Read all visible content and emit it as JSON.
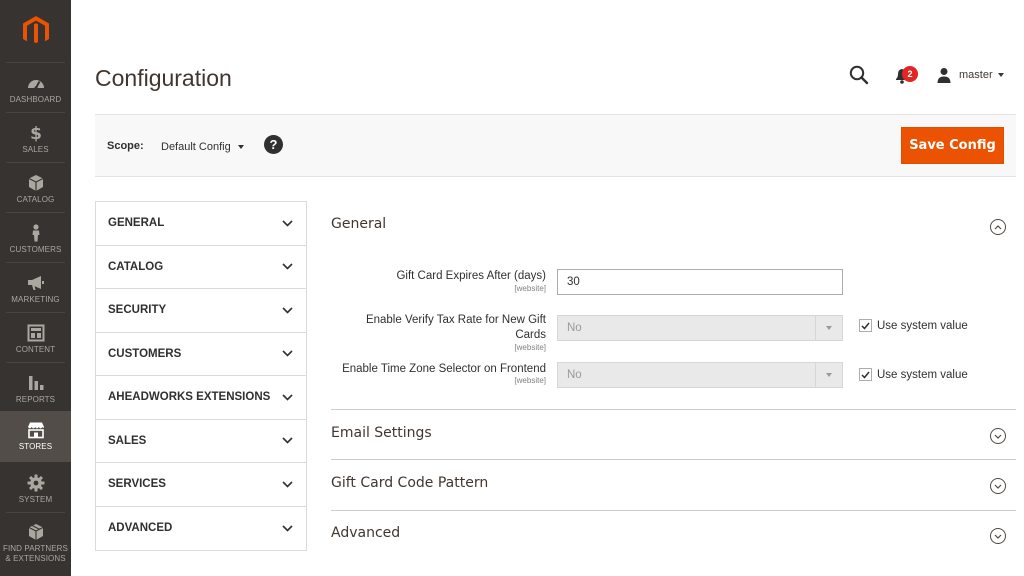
{
  "nav": {
    "items": [
      {
        "key": "dashboard",
        "label": "DASHBOARD"
      },
      {
        "key": "sales",
        "label": "SALES"
      },
      {
        "key": "catalog",
        "label": "CATALOG"
      },
      {
        "key": "customers",
        "label": "CUSTOMERS"
      },
      {
        "key": "marketing",
        "label": "MARKETING"
      },
      {
        "key": "content",
        "label": "CONTENT"
      },
      {
        "key": "reports",
        "label": "REPORTS"
      },
      {
        "key": "stores",
        "label": "STORES",
        "active": true
      },
      {
        "key": "system",
        "label": "SYSTEM"
      },
      {
        "key": "partners",
        "label": "FIND PARTNERS & EXTENSIONS"
      }
    ],
    "logo_icon": "magento-logo",
    "logo_color": "#eb5202"
  },
  "header": {
    "title": "Configuration",
    "notification_count": "2",
    "username": "master"
  },
  "scope": {
    "label": "Scope:",
    "value": "Default Config",
    "help": "?",
    "save_label": "Save Config"
  },
  "sections": [
    {
      "label": "GENERAL"
    },
    {
      "label": "CATALOG"
    },
    {
      "label": "SECURITY"
    },
    {
      "label": "CUSTOMERS"
    },
    {
      "label": "AHEADWORKS EXTENSIONS"
    },
    {
      "label": "SALES"
    },
    {
      "label": "SERVICES"
    },
    {
      "label": "ADVANCED"
    }
  ],
  "groups": {
    "general": {
      "title": "General",
      "expanded": true,
      "fields": {
        "expires": {
          "label": "Gift Card Expires After (days)",
          "scope": "[website]",
          "value": "30"
        },
        "verify_tax": {
          "label": "Enable Verify Tax Rate for New Gift Cards",
          "scope": "[website]",
          "value": "No",
          "use_system": "Use system value",
          "checked": true
        },
        "timezone": {
          "label": "Enable Time Zone Selector on Frontend",
          "scope": "[website]",
          "value": "No",
          "use_system": "Use system value",
          "checked": true
        }
      }
    },
    "email": {
      "title": "Email Settings",
      "expanded": false
    },
    "code_pattern": {
      "title": "Gift Card Code Pattern",
      "expanded": false
    },
    "advanced": {
      "title": "Advanced",
      "expanded": false
    }
  },
  "colors": {
    "accent": "#eb5202",
    "sidebar": "#373330",
    "badge": "#e22626"
  }
}
